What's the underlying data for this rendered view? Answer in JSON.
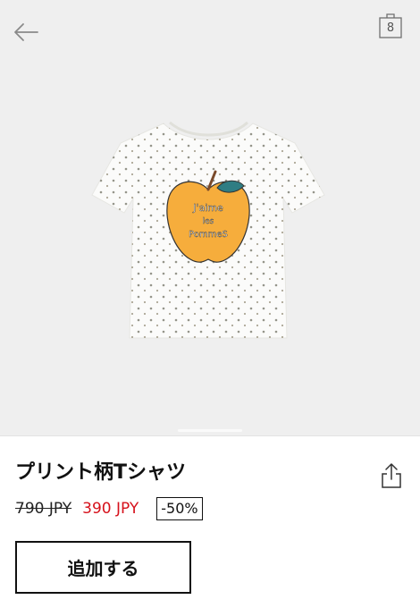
{
  "header": {
    "back_icon": "arrow-left-icon",
    "cart_icon": "shopping-bag-icon",
    "cart_count": "8"
  },
  "gallery": {
    "image_description_icon": "product-image",
    "print_text_line1": "J'aime",
    "print_text_line2": "les",
    "print_text_line3": "PommeS",
    "active_slide": 1,
    "slide_count": 1
  },
  "product": {
    "title": "プリント柄Tシャツ",
    "original_price": "790 JPY",
    "sale_price": "390 JPY",
    "discount": "-50%",
    "share_icon": "share-icon"
  },
  "actions": {
    "add_label": "追加する"
  },
  "colors": {
    "sale": "#d6111b",
    "hero_bg": "#efefef",
    "apple": "#f6ad3c"
  }
}
